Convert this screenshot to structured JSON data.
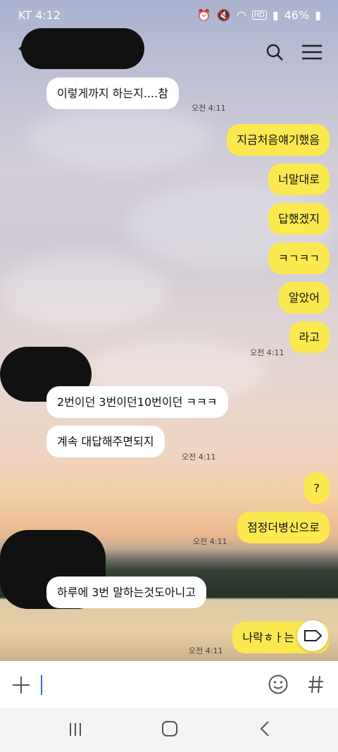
{
  "status_bar": {
    "carrier_time": "KT 4:12",
    "battery": "46%"
  },
  "messages": [
    {
      "side": "in",
      "text": "이렇게까지 하는지....참"
    },
    {
      "side": "in",
      "text": "",
      "time": "오전 4:11"
    },
    {
      "side": "out",
      "text": "지금처음얘기했음"
    },
    {
      "side": "out",
      "text": "너말대로"
    },
    {
      "side": "out",
      "text": "답했겠지"
    },
    {
      "side": "out",
      "text": "ㅋㄱㅋㄱ"
    },
    {
      "side": "out",
      "text": "알았어"
    },
    {
      "side": "out",
      "text": "라고",
      "time": "오전 4:11"
    },
    {
      "side": "in",
      "text": "2번이던 3번이던10번이던 ㅋㅋㅋ"
    },
    {
      "side": "in",
      "text": "계속 대답해주면되지",
      "time": "오전 4:11"
    },
    {
      "side": "out",
      "text": "?"
    },
    {
      "side": "out",
      "text": "점정더병신으로",
      "time": "오전 4:11"
    },
    {
      "side": "in",
      "text": "하루에 3번 말하는것도아니고"
    },
    {
      "side": "out",
      "text": "나락ㅎㅏ는",
      "time": "오전 4:11"
    }
  ],
  "times": {
    "t1": "오전 4:11",
    "t2": "오전 4:11",
    "t3": "오전 4:11",
    "t4": "오전 4:11",
    "t5": "오전 4:11"
  }
}
